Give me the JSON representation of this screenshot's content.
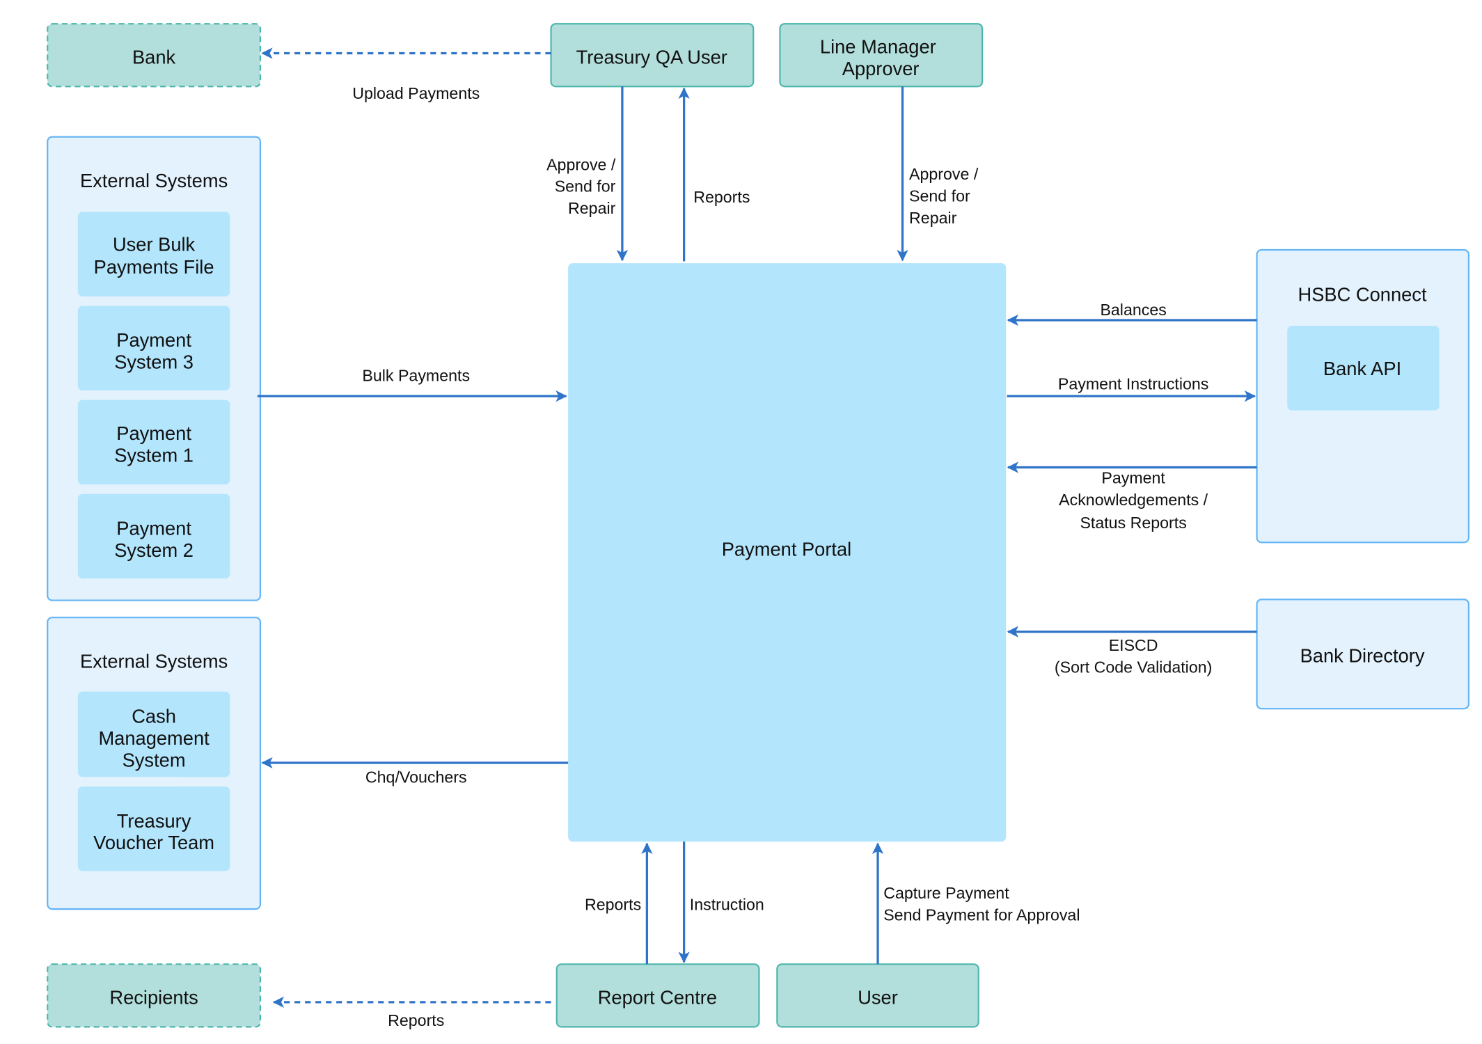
{
  "nodes": {
    "bank": "Bank",
    "treasury_qa_user": "Treasury QA User",
    "line_manager_approver": [
      "Line Manager",
      "Approver"
    ],
    "external_systems_1": {
      "title": "External Systems",
      "items": [
        [
          "User Bulk",
          "Payments File"
        ],
        [
          "Payment",
          "System 3"
        ],
        [
          "Payment",
          "System 1"
        ],
        [
          "Payment",
          "System 2"
        ]
      ]
    },
    "external_systems_2": {
      "title": "External Systems",
      "items": [
        [
          "Cash",
          "Management",
          "System"
        ],
        [
          "Treasury",
          "Voucher Team"
        ]
      ]
    },
    "recipients": "Recipients",
    "payment_portal": "Payment Portal",
    "hsbc_connect": {
      "title": "HSBC Connect",
      "items": [
        "Bank API"
      ]
    },
    "bank_directory": "Bank Directory",
    "report_centre": "Report Centre",
    "user": "User"
  },
  "edges": {
    "upload_payments": "Upload Payments",
    "treasury_approve": [
      "Approve /",
      "Send for",
      "Repair"
    ],
    "treasury_reports": "Reports",
    "manager_approve": [
      "Approve /",
      "Send for",
      "Repair"
    ],
    "bulk_payments": "Bulk Payments",
    "balances": "Balances",
    "payment_instructions": "Payment Instructions",
    "acknowledgements": [
      "Payment",
      "Acknowledgements /",
      "Status Reports"
    ],
    "eiscd": [
      "EISCD",
      "(Sort Code Validation)"
    ],
    "chq_vouchers": "Chq/Vouchers",
    "report_centre_reports": "Reports",
    "instruction": "Instruction",
    "user_capture": [
      "Capture Payment",
      "Send Payment for Approval"
    ],
    "recipients_reports": "Reports"
  },
  "colors": {
    "actor_fill": "#b2dfdb",
    "actor_stroke": "#4db6ac",
    "group_fill": "#e3f2fd",
    "group_stroke": "#64b5f6",
    "inner_fill": "#b3e5fc",
    "arrow": "#2f74c8"
  }
}
